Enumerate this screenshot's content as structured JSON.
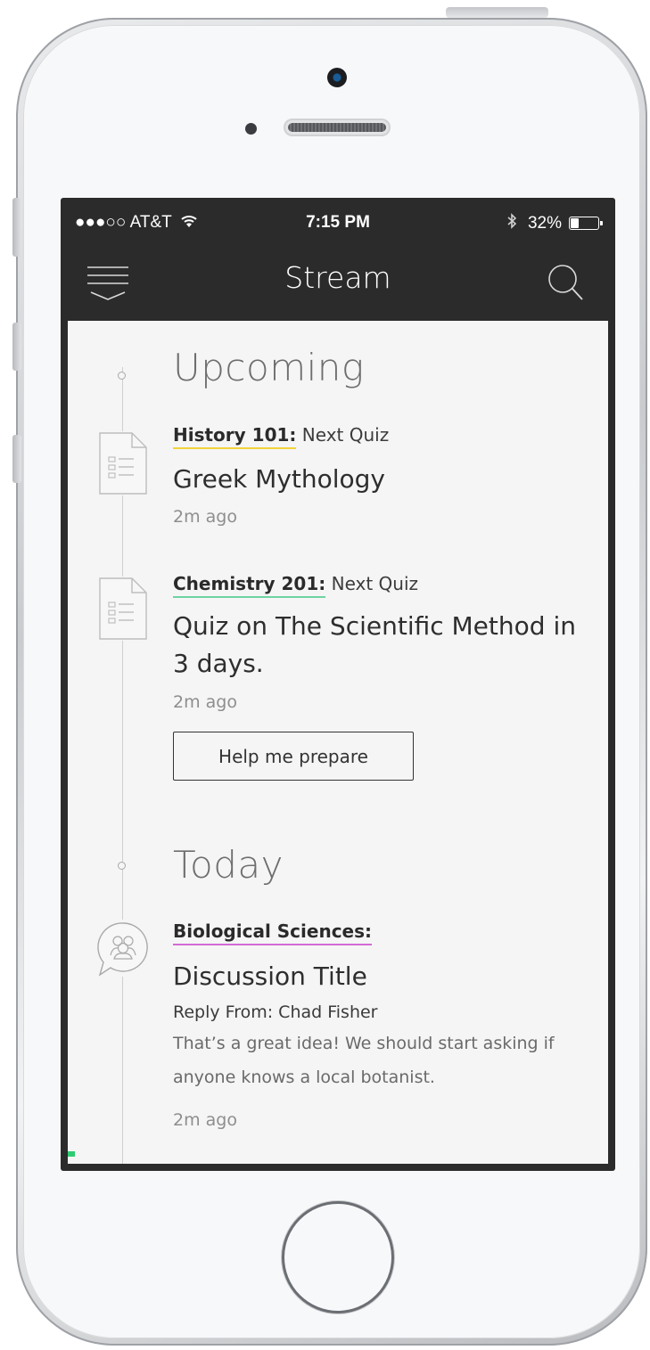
{
  "status_bar": {
    "carrier": "●●●○○ AT&T",
    "time": "7:15 PM",
    "battery_text": "32%",
    "battery_level": 0.32
  },
  "nav": {
    "title": "Stream",
    "menu_icon": "menu-icon",
    "search_icon": "search-icon"
  },
  "sections": {
    "upcoming": {
      "title": "Upcoming",
      "items": [
        {
          "course": "History 101:",
          "suffix": " Next Quiz",
          "underline_color": "#f2d33b",
          "title": "Greek Mythology",
          "time": "2m ago",
          "icon": "document-icon"
        },
        {
          "course": "Chemistry 201:",
          "suffix": " Next Quiz",
          "underline_color": "#6fd3a2",
          "title": "Quiz on The Scientific Method in 3 days.",
          "time": "2m ago",
          "icon": "document-icon",
          "button_label": "Help me prepare"
        }
      ]
    },
    "today": {
      "title": "Today",
      "items": [
        {
          "course": "Biological Sciences:",
          "underline_color": "#d36bd6",
          "title": "Discussion Title",
          "reply_from": "Reply From: Chad Fisher",
          "body": "That’s a great idea! We should start asking if anyone knows a local botanist.",
          "time": "2m ago",
          "icon": "discussion-icon"
        }
      ]
    }
  }
}
